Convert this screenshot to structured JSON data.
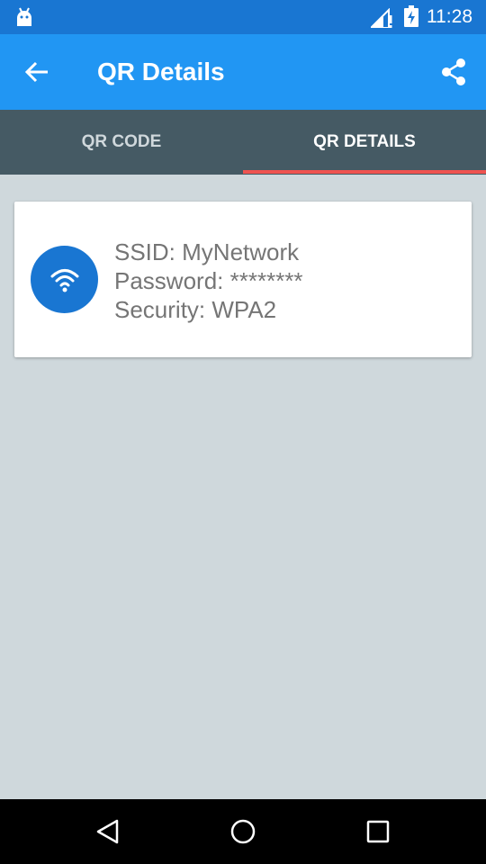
{
  "status_bar": {
    "time": "11:28",
    "icons": [
      "android-debug-icon",
      "signal-icon",
      "battery-charging-icon"
    ]
  },
  "app_bar": {
    "title": "QR Details",
    "back_icon": "arrow-back-icon",
    "share_icon": "share-icon",
    "color": "#2196f3"
  },
  "tabs": {
    "items": [
      {
        "label": "QR CODE",
        "selected": false
      },
      {
        "label": "QR DETAILS",
        "selected": true
      }
    ],
    "background": "#455a64",
    "indicator_color": "#ef5350"
  },
  "card": {
    "icon": "wifi-icon",
    "icon_bg": "#1976d2",
    "ssid": "SSID: MyNetwork",
    "password": "Password: ********",
    "security": "Security: WPA2"
  },
  "nav_bar": {
    "buttons": [
      "back-triangle-icon",
      "home-circle-icon",
      "recents-square-icon"
    ]
  },
  "colors": {
    "status_bar": "#1976d2",
    "background": "#cfd8dc"
  }
}
